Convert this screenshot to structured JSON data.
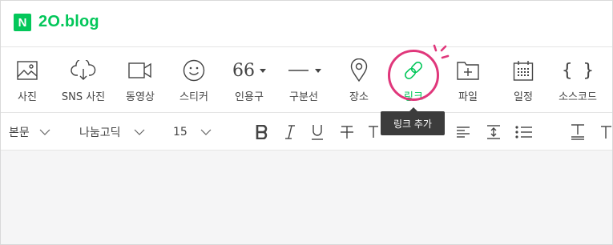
{
  "brand": {
    "badge": "N",
    "name": "2O.blog",
    "color": "#03c75a"
  },
  "toolbar": {
    "items": [
      {
        "label": "사진",
        "icon": "photo-icon"
      },
      {
        "label": "SNS 사진",
        "icon": "cloud-download-icon"
      },
      {
        "label": "동영상",
        "icon": "video-icon"
      },
      {
        "label": "스티커",
        "icon": "smiley-icon"
      },
      {
        "label": "인용구",
        "icon": "quote-icon",
        "glyph": "66"
      },
      {
        "label": "구분선",
        "icon": "divider-icon"
      },
      {
        "label": "장소",
        "icon": "map-pin-icon"
      },
      {
        "label": "링크",
        "icon": "link-icon",
        "active": true
      },
      {
        "label": "파일",
        "icon": "folder-add-icon"
      },
      {
        "label": "일정",
        "icon": "calendar-icon"
      },
      {
        "label": "소스코드",
        "icon": "code-braces-icon",
        "glyph": "{ }"
      }
    ],
    "active_color": "#03c75a",
    "highlight_color": "#e0377b"
  },
  "tooltip": {
    "text": "링크 추가"
  },
  "format": {
    "paragraph": "본문",
    "font": "나눔고딕",
    "size": "15"
  }
}
